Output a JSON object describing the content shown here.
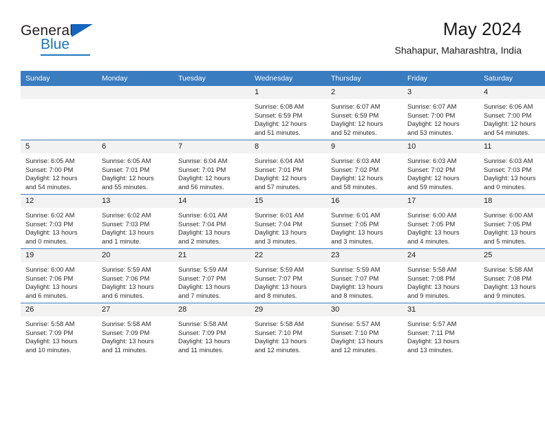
{
  "brand": {
    "name_top": "General",
    "name_bottom": "Blue",
    "accent_color": "#1b75bc"
  },
  "header": {
    "title": "May 2024",
    "subtitle": "Shahapur, Maharashtra, India"
  },
  "theme": {
    "header_blue": "#3a7cc0",
    "daynum_gray": "#f2f2f2",
    "text": "#1a1a1a"
  },
  "weekdays": [
    "Sunday",
    "Monday",
    "Tuesday",
    "Wednesday",
    "Thursday",
    "Friday",
    "Saturday"
  ],
  "weeks": [
    [
      {
        "day": "",
        "empty": true
      },
      {
        "day": "",
        "empty": true
      },
      {
        "day": "",
        "empty": true
      },
      {
        "day": "1",
        "sunrise": "Sunrise: 6:08 AM",
        "sunset": "Sunset: 6:59 PM",
        "daylight1": "Daylight: 12 hours",
        "daylight2": "and 51 minutes."
      },
      {
        "day": "2",
        "sunrise": "Sunrise: 6:07 AM",
        "sunset": "Sunset: 6:59 PM",
        "daylight1": "Daylight: 12 hours",
        "daylight2": "and 52 minutes."
      },
      {
        "day": "3",
        "sunrise": "Sunrise: 6:07 AM",
        "sunset": "Sunset: 7:00 PM",
        "daylight1": "Daylight: 12 hours",
        "daylight2": "and 53 minutes."
      },
      {
        "day": "4",
        "sunrise": "Sunrise: 6:06 AM",
        "sunset": "Sunset: 7:00 PM",
        "daylight1": "Daylight: 12 hours",
        "daylight2": "and 54 minutes."
      }
    ],
    [
      {
        "day": "5",
        "sunrise": "Sunrise: 6:05 AM",
        "sunset": "Sunset: 7:00 PM",
        "daylight1": "Daylight: 12 hours",
        "daylight2": "and 54 minutes."
      },
      {
        "day": "6",
        "sunrise": "Sunrise: 6:05 AM",
        "sunset": "Sunset: 7:01 PM",
        "daylight1": "Daylight: 12 hours",
        "daylight2": "and 55 minutes."
      },
      {
        "day": "7",
        "sunrise": "Sunrise: 6:04 AM",
        "sunset": "Sunset: 7:01 PM",
        "daylight1": "Daylight: 12 hours",
        "daylight2": "and 56 minutes."
      },
      {
        "day": "8",
        "sunrise": "Sunrise: 6:04 AM",
        "sunset": "Sunset: 7:01 PM",
        "daylight1": "Daylight: 12 hours",
        "daylight2": "and 57 minutes."
      },
      {
        "day": "9",
        "sunrise": "Sunrise: 6:03 AM",
        "sunset": "Sunset: 7:02 PM",
        "daylight1": "Daylight: 12 hours",
        "daylight2": "and 58 minutes."
      },
      {
        "day": "10",
        "sunrise": "Sunrise: 6:03 AM",
        "sunset": "Sunset: 7:02 PM",
        "daylight1": "Daylight: 12 hours",
        "daylight2": "and 59 minutes."
      },
      {
        "day": "11",
        "sunrise": "Sunrise: 6:03 AM",
        "sunset": "Sunset: 7:03 PM",
        "daylight1": "Daylight: 13 hours",
        "daylight2": "and 0 minutes."
      }
    ],
    [
      {
        "day": "12",
        "sunrise": "Sunrise: 6:02 AM",
        "sunset": "Sunset: 7:03 PM",
        "daylight1": "Daylight: 13 hours",
        "daylight2": "and 0 minutes."
      },
      {
        "day": "13",
        "sunrise": "Sunrise: 6:02 AM",
        "sunset": "Sunset: 7:03 PM",
        "daylight1": "Daylight: 13 hours",
        "daylight2": "and 1 minute."
      },
      {
        "day": "14",
        "sunrise": "Sunrise: 6:01 AM",
        "sunset": "Sunset: 7:04 PM",
        "daylight1": "Daylight: 13 hours",
        "daylight2": "and 2 minutes."
      },
      {
        "day": "15",
        "sunrise": "Sunrise: 6:01 AM",
        "sunset": "Sunset: 7:04 PM",
        "daylight1": "Daylight: 13 hours",
        "daylight2": "and 3 minutes."
      },
      {
        "day": "16",
        "sunrise": "Sunrise: 6:01 AM",
        "sunset": "Sunset: 7:05 PM",
        "daylight1": "Daylight: 13 hours",
        "daylight2": "and 3 minutes."
      },
      {
        "day": "17",
        "sunrise": "Sunrise: 6:00 AM",
        "sunset": "Sunset: 7:05 PM",
        "daylight1": "Daylight: 13 hours",
        "daylight2": "and 4 minutes."
      },
      {
        "day": "18",
        "sunrise": "Sunrise: 6:00 AM",
        "sunset": "Sunset: 7:05 PM",
        "daylight1": "Daylight: 13 hours",
        "daylight2": "and 5 minutes."
      }
    ],
    [
      {
        "day": "19",
        "sunrise": "Sunrise: 6:00 AM",
        "sunset": "Sunset: 7:06 PM",
        "daylight1": "Daylight: 13 hours",
        "daylight2": "and 6 minutes."
      },
      {
        "day": "20",
        "sunrise": "Sunrise: 5:59 AM",
        "sunset": "Sunset: 7:06 PM",
        "daylight1": "Daylight: 13 hours",
        "daylight2": "and 6 minutes."
      },
      {
        "day": "21",
        "sunrise": "Sunrise: 5:59 AM",
        "sunset": "Sunset: 7:07 PM",
        "daylight1": "Daylight: 13 hours",
        "daylight2": "and 7 minutes."
      },
      {
        "day": "22",
        "sunrise": "Sunrise: 5:59 AM",
        "sunset": "Sunset: 7:07 PM",
        "daylight1": "Daylight: 13 hours",
        "daylight2": "and 8 minutes."
      },
      {
        "day": "23",
        "sunrise": "Sunrise: 5:59 AM",
        "sunset": "Sunset: 7:07 PM",
        "daylight1": "Daylight: 13 hours",
        "daylight2": "and 8 minutes."
      },
      {
        "day": "24",
        "sunrise": "Sunrise: 5:58 AM",
        "sunset": "Sunset: 7:08 PM",
        "daylight1": "Daylight: 13 hours",
        "daylight2": "and 9 minutes."
      },
      {
        "day": "25",
        "sunrise": "Sunrise: 5:58 AM",
        "sunset": "Sunset: 7:08 PM",
        "daylight1": "Daylight: 13 hours",
        "daylight2": "and 9 minutes."
      }
    ],
    [
      {
        "day": "26",
        "sunrise": "Sunrise: 5:58 AM",
        "sunset": "Sunset: 7:09 PM",
        "daylight1": "Daylight: 13 hours",
        "daylight2": "and 10 minutes."
      },
      {
        "day": "27",
        "sunrise": "Sunrise: 5:58 AM",
        "sunset": "Sunset: 7:09 PM",
        "daylight1": "Daylight: 13 hours",
        "daylight2": "and 11 minutes."
      },
      {
        "day": "28",
        "sunrise": "Sunrise: 5:58 AM",
        "sunset": "Sunset: 7:09 PM",
        "daylight1": "Daylight: 13 hours",
        "daylight2": "and 11 minutes."
      },
      {
        "day": "29",
        "sunrise": "Sunrise: 5:58 AM",
        "sunset": "Sunset: 7:10 PM",
        "daylight1": "Daylight: 13 hours",
        "daylight2": "and 12 minutes."
      },
      {
        "day": "30",
        "sunrise": "Sunrise: 5:57 AM",
        "sunset": "Sunset: 7:10 PM",
        "daylight1": "Daylight: 13 hours",
        "daylight2": "and 12 minutes."
      },
      {
        "day": "31",
        "sunrise": "Sunrise: 5:57 AM",
        "sunset": "Sunset: 7:11 PM",
        "daylight1": "Daylight: 13 hours",
        "daylight2": "and 13 minutes."
      },
      {
        "day": "",
        "empty": true
      }
    ]
  ]
}
